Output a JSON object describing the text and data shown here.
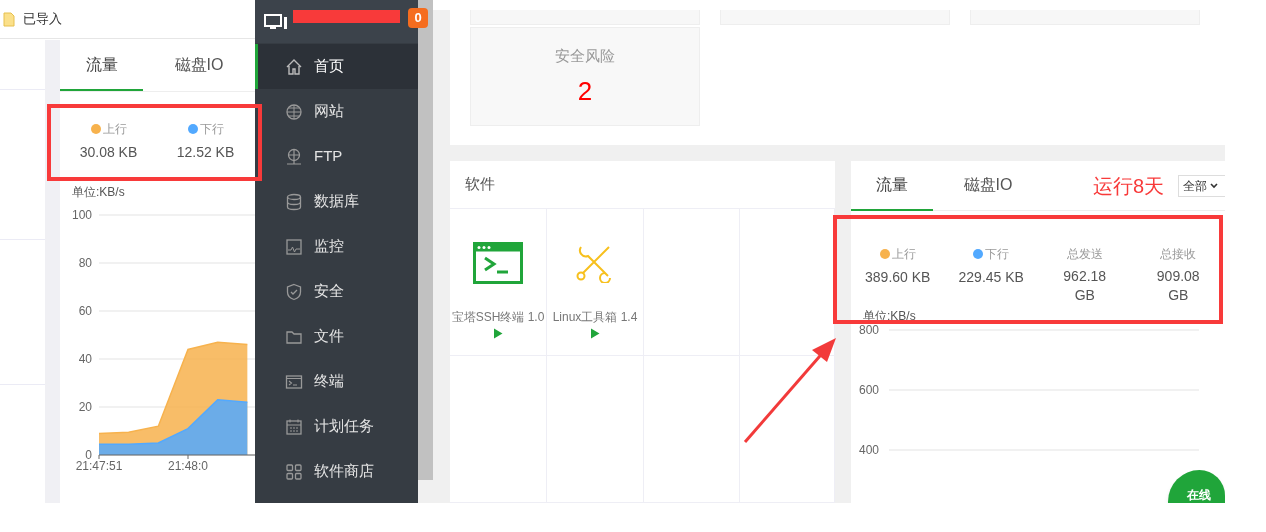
{
  "top_bar": {
    "folder_label": "已导入"
  },
  "left_traffic_panel": {
    "tabs": [
      {
        "label": "流量",
        "selected": true
      },
      {
        "label": "磁盘IO",
        "selected": false
      }
    ],
    "stats": [
      {
        "kind": "rate",
        "label": "上行",
        "color": "#f7b24d",
        "value": "30.08 KB"
      },
      {
        "kind": "rate",
        "label": "下行",
        "color": "#52a9ff",
        "value": "12.52 KB"
      }
    ],
    "chart_data": {
      "type": "area",
      "ylabel": "单位:KB/s",
      "grid": true,
      "stacked": false,
      "categories": [
        "21:47:51",
        null,
        null,
        "21:48:0",
        null,
        null
      ],
      "ylim": [
        0,
        100
      ],
      "yticks": [
        0,
        20,
        40,
        60,
        80,
        100
      ],
      "series": [
        {
          "color": "#f7b24d",
          "values": [
            9,
            9.5,
            12,
            44,
            47,
            46
          ]
        },
        {
          "color": "#52a9ff",
          "values": [
            4.5,
            4.5,
            5,
            11,
            23,
            22
          ]
        }
      ]
    }
  },
  "sidebar": {
    "badge": "0",
    "items": [
      {
        "label": "首页",
        "selected": true
      },
      {
        "label": "网站",
        "selected": false
      },
      {
        "label": "FTP",
        "selected": false
      },
      {
        "label": "数据库",
        "selected": false
      },
      {
        "label": "监控",
        "selected": false
      },
      {
        "label": "安全",
        "selected": false
      },
      {
        "label": "文件",
        "selected": false
      },
      {
        "label": "终端",
        "selected": false
      },
      {
        "label": "计划任务",
        "selected": false
      },
      {
        "label": "软件商店",
        "selected": false
      }
    ]
  },
  "summary_cards": [
    {
      "title": "安全风险",
      "value": "2"
    }
  ],
  "software_panel": {
    "title": "软件",
    "items": [
      {
        "name": "宝塔SSH终端 1.0"
      },
      {
        "name": "Linux工具箱 1.4"
      }
    ]
  },
  "right_traffic_panel": {
    "tabs": [
      {
        "label": "流量",
        "selected": true
      },
      {
        "label": "磁盘IO",
        "selected": false
      }
    ],
    "uptime": "运行8天",
    "range_select": {
      "value": "全部"
    },
    "stats": [
      {
        "kind": "rate",
        "label": "上行",
        "color": "#f7b24d",
        "value": "389.60 KB"
      },
      {
        "kind": "rate",
        "label": "下行",
        "color": "#52a9ff",
        "value": "229.45 KB"
      },
      {
        "kind": "total",
        "label": "总发送",
        "value": "962.18 GB"
      },
      {
        "kind": "total",
        "label": "总接收",
        "value": "909.08 GB"
      }
    ],
    "empty_chart": {
      "unit_label": "单位:KB/s",
      "y_labels": [
        "800",
        "600",
        "400"
      ]
    }
  },
  "online_button": "在线"
}
